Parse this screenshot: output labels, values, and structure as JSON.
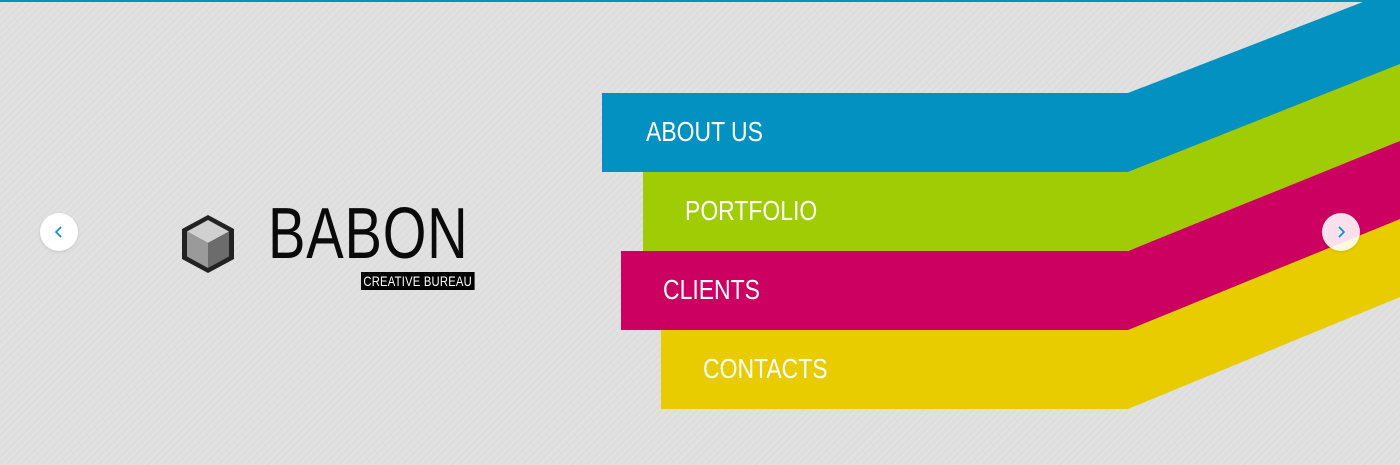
{
  "brand": {
    "name": "BABON",
    "tagline": "CREATIVE BUREAU",
    "logo_icon": "cube-icon"
  },
  "nav": {
    "items": [
      {
        "label": "ABOUT US",
        "color": "#0291c1"
      },
      {
        "label": "PORTFOLIO",
        "color": "#9fcc04"
      },
      {
        "label": "CLIENTS",
        "color": "#cc0060"
      },
      {
        "label": "CONTACTS",
        "color": "#e9cc00"
      }
    ]
  },
  "slider": {
    "prev_icon": "chevron-left-icon",
    "next_icon": "chevron-right-icon",
    "arrow_color": "#0291c1"
  },
  "theme": {
    "background": "#dedede",
    "top_line": "#0291c1"
  }
}
